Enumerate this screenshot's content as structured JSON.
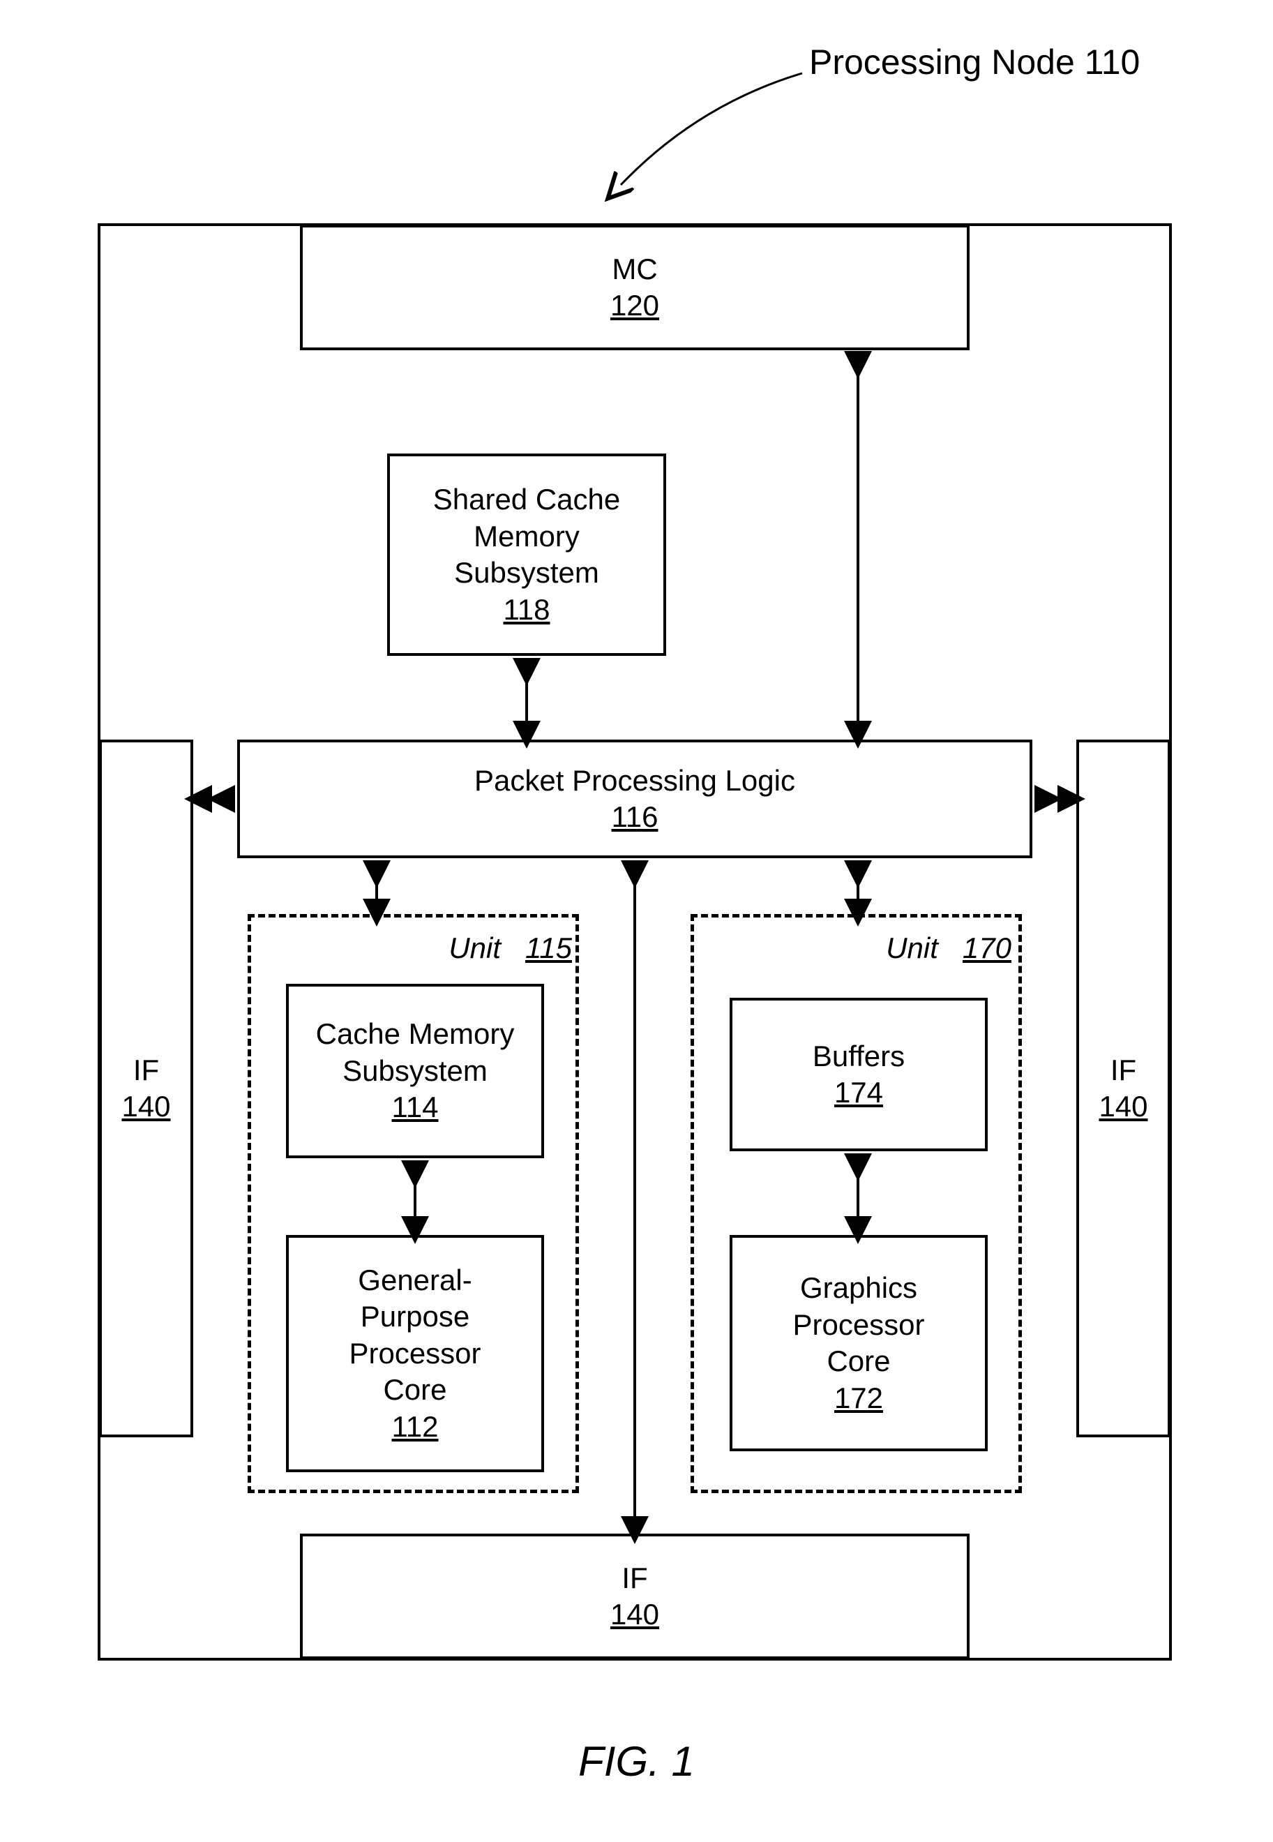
{
  "pointer_label": "Processing Node 110",
  "outer": {},
  "mc": {
    "title": "MC",
    "num": "120"
  },
  "scms": {
    "l1": "Shared Cache",
    "l2": "Memory",
    "l3": "Subsystem",
    "num": "118"
  },
  "ppl": {
    "title": "Packet Processing Logic",
    "num": "116"
  },
  "if_left": {
    "title": "IF",
    "num": "140"
  },
  "if_right": {
    "title": "IF",
    "num": "140"
  },
  "if_bottom": {
    "title": "IF",
    "num": "140"
  },
  "unit115": {
    "label": "Unit",
    "num": "115"
  },
  "unit170": {
    "label": "Unit",
    "num": "170"
  },
  "cms": {
    "l1": "Cache Memory",
    "l2": "Subsystem",
    "num": "114"
  },
  "gpp": {
    "l1": "General-",
    "l2": "Purpose",
    "l3": "Processor",
    "l4": "Core",
    "num": "112"
  },
  "buffers": {
    "title": "Buffers",
    "num": "174"
  },
  "gpc": {
    "l1": "Graphics",
    "l2": "Processor",
    "l3": "Core",
    "num": "172"
  },
  "fig": "FIG. 1"
}
